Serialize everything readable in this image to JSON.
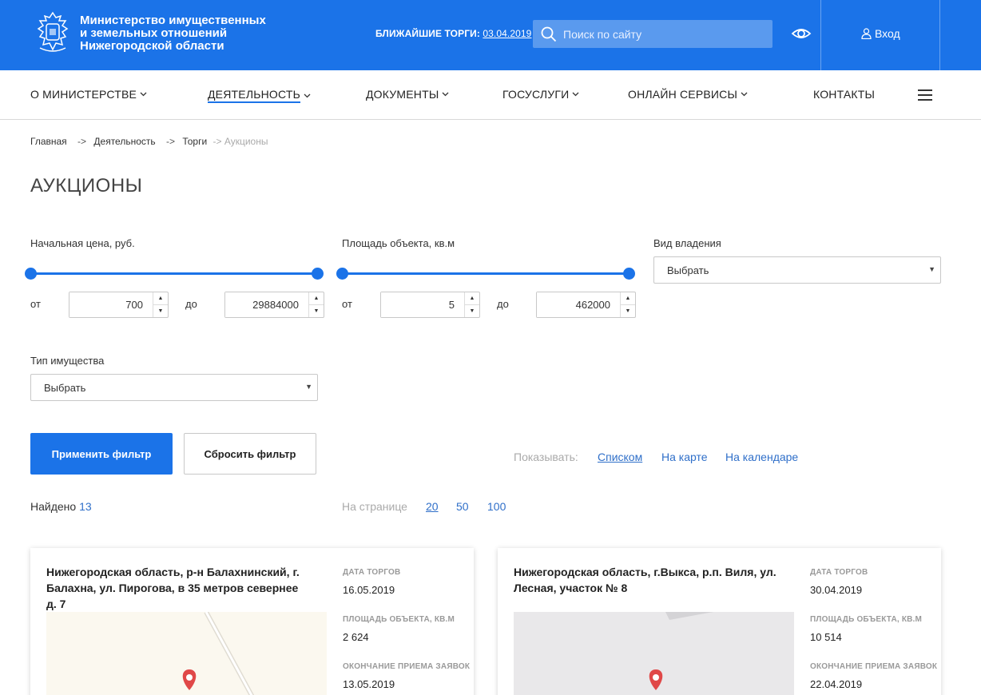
{
  "header": {
    "org_line1": "Министерство имущественных",
    "org_line2": "и земельных отношений",
    "org_line3": "Нижегородской области",
    "next_auction_label": "БЛИЖАЙШИЕ ТОРГИ:",
    "next_auction_date": "03.04.2019",
    "search_placeholder": "Поиск по сайту",
    "login_label": "Вход",
    "brand_color": "#1b73e8"
  },
  "nav": {
    "items": [
      {
        "label": "О МИНИСТЕРСТВЕ",
        "has_dropdown": true,
        "active": false
      },
      {
        "label": "ДЕЯТЕЛЬНОСТЬ",
        "has_dropdown": true,
        "active": true
      },
      {
        "label": "ДОКУМЕНТЫ",
        "has_dropdown": true,
        "active": false
      },
      {
        "label": "ГОСУСЛУГИ",
        "has_dropdown": true,
        "active": false
      },
      {
        "label": "ОНЛАЙН СЕРВИСЫ",
        "has_dropdown": true,
        "active": false
      },
      {
        "label": "КОНТАКТЫ",
        "has_dropdown": false,
        "active": false
      }
    ]
  },
  "breadcrumb": {
    "items": [
      "Главная",
      "Деятельность",
      "Торги"
    ],
    "separator": "->",
    "current": "-> Аукционы"
  },
  "page_title": "АУКЦИОНЫ",
  "filters": {
    "price": {
      "label": "Начальная цена, руб.",
      "from_label": "от",
      "to_label": "до",
      "from": "700",
      "to": "29884000"
    },
    "area": {
      "label": "Площадь объекта, кв.м",
      "from_label": "от",
      "to_label": "до",
      "from": "5",
      "to": "462000"
    },
    "ownership": {
      "label": "Вид владения",
      "value": "Выбрать"
    },
    "property_type": {
      "label": "Тип имущества",
      "value": "Выбрать"
    },
    "apply_label": "Применить фильтр",
    "reset_label": "Сбросить фильтр"
  },
  "view": {
    "label": "Показывать:",
    "options": [
      "Списком",
      "На карте",
      "На календаре"
    ],
    "active": "Списком"
  },
  "results": {
    "found_label": "Найдено",
    "found_count": "13",
    "per_page_label": "На странице",
    "per_page_options": [
      "20",
      "50",
      "100"
    ],
    "per_page_active": "20"
  },
  "cards": [
    {
      "address": "Нижегородская область, р-н Балахнинский, г. Балахна, ул. Пирогова, в 35 метров севернее д. 7",
      "date_label": "ДАТА ТОРГОВ",
      "date": "16.05.2019",
      "area_label": "ПЛОЩАДЬ ОБЪЕКТА, КВ.М",
      "area": "2 624",
      "deadline_label": "ОКОНЧАНИЕ ПРИЕМА ЗАЯВОК",
      "deadline": "13.05.2019"
    },
    {
      "address": "Нижегородская область, г.Выкса, р.п. Виля, ул. Лесная, участок № 8",
      "date_label": "ДАТА ТОРГОВ",
      "date": "30.04.2019",
      "area_label": "ПЛОЩАДЬ ОБЪЕКТА, КВ.М",
      "area": "10 514",
      "deadline_label": "ОКОНЧАНИЕ ПРИЕМА ЗАЯВОК",
      "deadline": "22.04.2019"
    }
  ]
}
